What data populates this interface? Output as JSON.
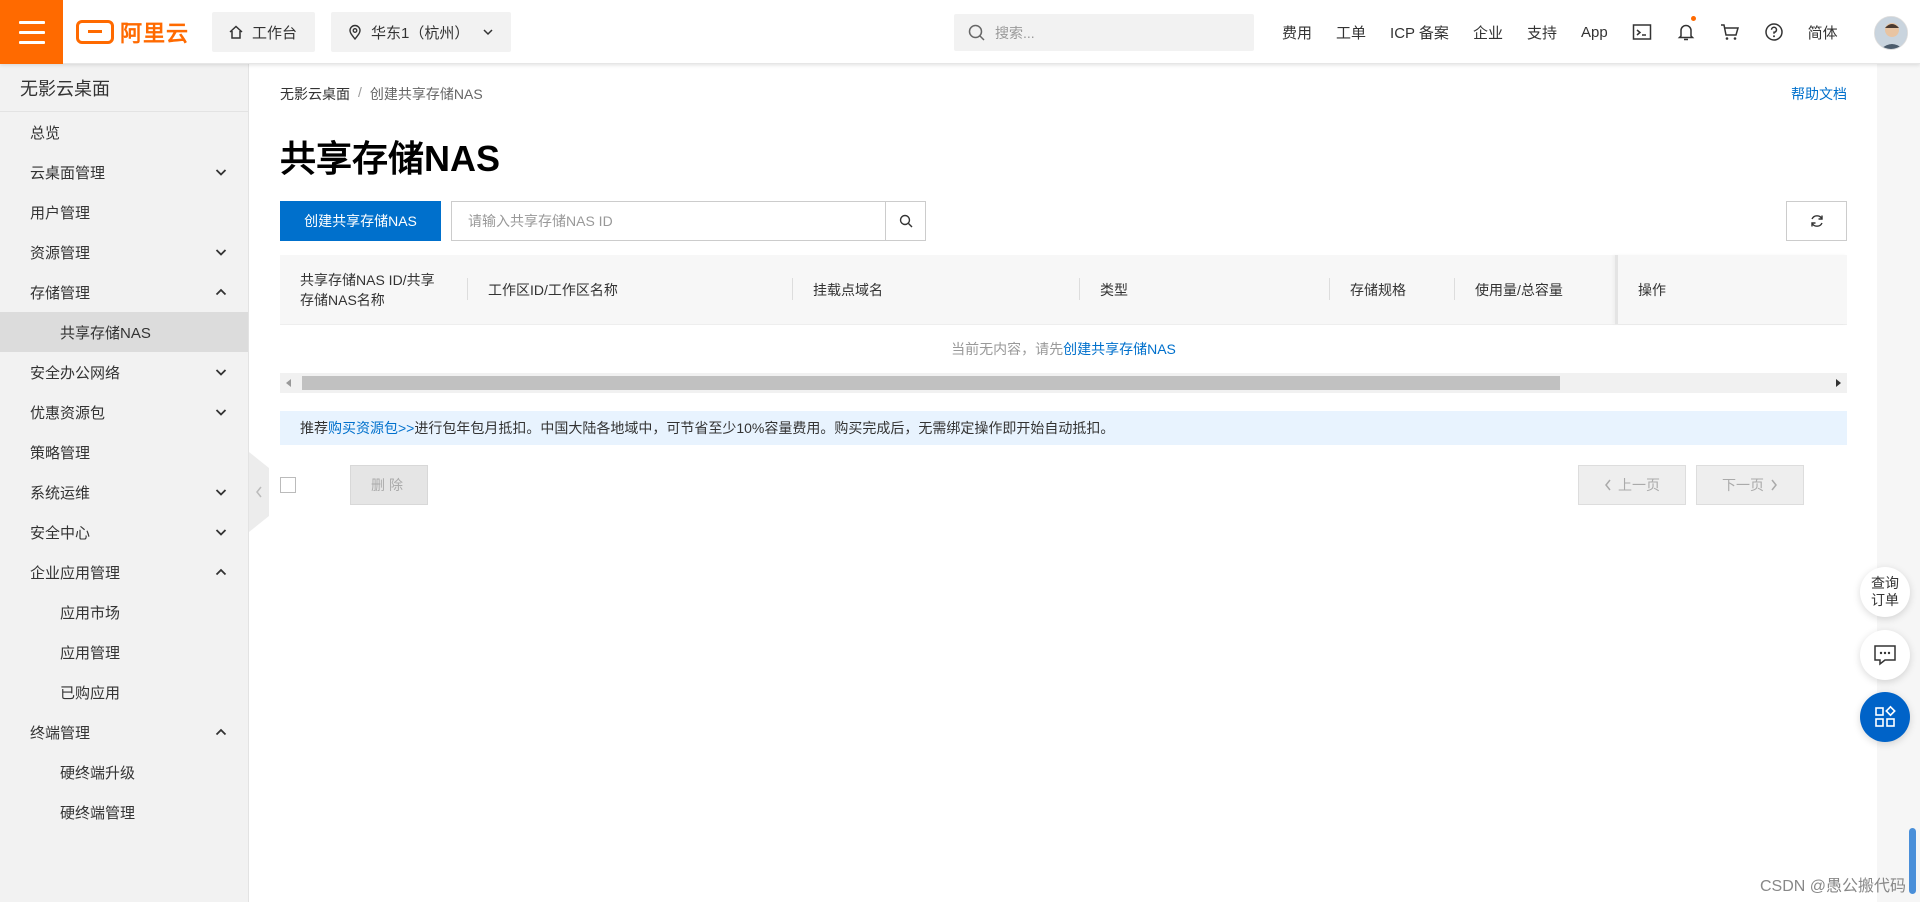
{
  "topbar": {
    "logo_text": "阿里云",
    "workbench": "工作台",
    "region": "华东1（杭州）",
    "search_placeholder": "搜索...",
    "nav": [
      "费用",
      "工单",
      "ICP 备案",
      "企业",
      "支持",
      "App"
    ],
    "lang": "简体",
    "icons": [
      "terminal-icon",
      "bell-icon",
      "cart-icon",
      "help-icon"
    ],
    "accent_color": "#ff6a00"
  },
  "sidebar": {
    "title": "无影云桌面",
    "items": [
      {
        "label": "总览"
      },
      {
        "label": "云桌面管理",
        "expand": "down"
      },
      {
        "label": "用户管理"
      },
      {
        "label": "资源管理",
        "expand": "down"
      },
      {
        "label": "存储管理",
        "expand": "up"
      },
      {
        "label": "共享存储NAS",
        "sub": true,
        "active": true
      },
      {
        "label": "安全办公网络",
        "expand": "down"
      },
      {
        "label": "优惠资源包",
        "expand": "down"
      },
      {
        "label": "策略管理"
      },
      {
        "label": "系统运维",
        "expand": "down"
      },
      {
        "label": "安全中心",
        "expand": "down"
      },
      {
        "label": "企业应用管理",
        "expand": "up"
      },
      {
        "label": "应用市场",
        "sub": true
      },
      {
        "label": "应用管理",
        "sub": true
      },
      {
        "label": "已购应用",
        "sub": true
      },
      {
        "label": "终端管理",
        "expand": "up"
      },
      {
        "label": "硬终端升级",
        "sub": true
      },
      {
        "label": "硬终端管理",
        "sub": true
      }
    ]
  },
  "main": {
    "breadcrumb": {
      "root": "无影云桌面",
      "sep": "/",
      "current": "创建共享存储NAS"
    },
    "help": "帮助文档",
    "title": "共享存储NAS",
    "create_button": "创建共享存储NAS",
    "filter_placeholder": "请输入共享存储NAS ID",
    "columns": [
      "共享存储NAS ID/共享存储NAS名称",
      "工作区ID/工作区名称",
      "挂载点域名",
      "类型",
      "存储规格",
      "使用量/总容量",
      "操作"
    ],
    "empty_prefix": "当前无内容，请先",
    "empty_link": "创建共享存储NAS",
    "notice_prefix": "推荐",
    "notice_link": "购买资源包>>",
    "notice_suffix": "进行包年包月抵扣。中国大陆各地域中，可节省至少10%容量费用。购买完成后，无需绑定操作即开始自动抵扣。",
    "delete_button": "删除",
    "prev_button": "上一页",
    "next_button": "下一页",
    "link_color": "#0070cc"
  },
  "floating": {
    "query_line1": "查询",
    "query_line2": "订单"
  },
  "watermark": "CSDN @愚公搬代码"
}
